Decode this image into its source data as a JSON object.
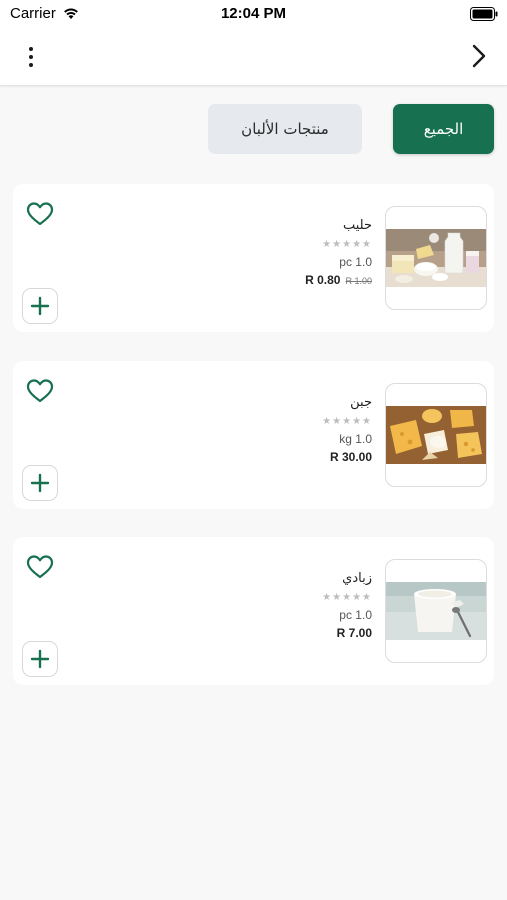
{
  "status_bar": {
    "carrier": "Carrier",
    "time": "12:04 PM"
  },
  "nav": {
    "menu_icon": "more-vertical-icon",
    "back_icon": "chevron-right-icon"
  },
  "tabs": [
    {
      "label": "الجميع",
      "active": true
    },
    {
      "label": "منتجات الألبان",
      "active": false
    }
  ],
  "colors": {
    "primary": "#17704f",
    "tab_inactive": "#e6e9ed",
    "background": "#f8f8f8"
  },
  "products": [
    {
      "name": "حليب",
      "rating_stars": "★★★★★",
      "rating": 0,
      "quantity": "pc 1.0",
      "price": "R 0.80",
      "old_price": "R 1.00",
      "image": "dairy-products-image"
    },
    {
      "name": "جبن",
      "rating_stars": "★★★★★",
      "rating": 0,
      "quantity": "kg 1.0",
      "price": "R 30.00",
      "old_price": "",
      "image": "cheese-image"
    },
    {
      "name": "زبادي",
      "rating_stars": "★★★★★",
      "rating": 0,
      "quantity": "pc 1.0",
      "price": "R 7.00",
      "old_price": "",
      "image": "yogurt-image"
    }
  ]
}
